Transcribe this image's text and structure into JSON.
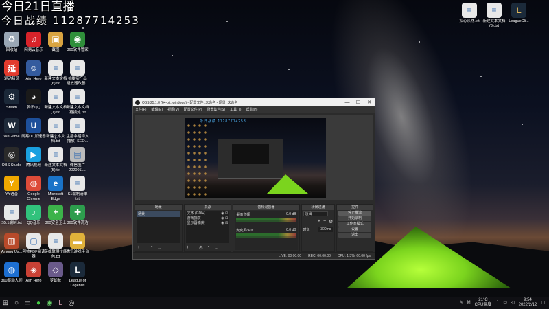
{
  "overlay": {
    "line1": "今日21日直播",
    "line2": "今日战绩 11287714253"
  },
  "desktop": {
    "icons": [
      {
        "label": "回收站",
        "icon": "recycle-bin-icon",
        "color": "#9aa7b5",
        "glyph": "♻"
      },
      {
        "label": "网易云音乐",
        "icon": "netease-music-icon",
        "color": "#d8232a",
        "glyph": "♫"
      },
      {
        "label": "截图",
        "icon": "screenshot-icon",
        "color": "#d9a441",
        "glyph": "▣"
      },
      {
        "label": "360软件管家",
        "icon": "360-software-icon",
        "color": "#2f8f3a",
        "glyph": "◉"
      },
      {
        "label": "驱动精灵",
        "icon": "driver-icon",
        "color": "#e23b2e",
        "glyph": "延"
      },
      {
        "label": "Aim Hero",
        "icon": "aim-hero-icon",
        "color": "#345b9e",
        "glyph": "☺"
      },
      {
        "label": "新建文本文档\n(6).txt",
        "icon": "text-file-icon",
        "color": "#e8e8e8",
        "glyph": "≡"
      },
      {
        "label": "拍摄实产出\n播放器改善...",
        "icon": "text-file-icon",
        "color": "#e8e8e8",
        "glyph": "≡"
      },
      {
        "label": "Steam",
        "icon": "steam-icon",
        "color": "#1b2838",
        "glyph": "⚙"
      },
      {
        "label": "腾讯QQ",
        "icon": "qq-icon",
        "color": "#1a1a1a",
        "glyph": "◕"
      },
      {
        "label": "新建文本文档\n(7).txt",
        "icon": "text-file-icon",
        "color": "#e8e8e8",
        "glyph": "≡"
      },
      {
        "label": "新建文本文档\n链接处.txt",
        "icon": "text-file-icon",
        "color": "#e8e8e8",
        "glyph": "≡"
      },
      {
        "label": "WeGame",
        "icon": "wegame-icon",
        "color": "#1e2a3a",
        "glyph": "W"
      },
      {
        "label": "网易UU加速器",
        "icon": "uu-accelerator-icon",
        "color": "#1d4f9a",
        "glyph": "U"
      },
      {
        "label": "新建文本文\n档.txt",
        "icon": "text-file-icon",
        "color": "#e8e8e8",
        "glyph": "≡"
      },
      {
        "label": "主播伞招待入\n播放 -SEO...",
        "icon": "text-file-icon",
        "color": "#e8e8e8",
        "glyph": "≡"
      },
      {
        "label": "OBS Studio",
        "icon": "obs-icon",
        "color": "#2a2a2a",
        "glyph": "◎"
      },
      {
        "label": "腾讯视频",
        "icon": "tencent-video-icon",
        "color": "#1aa0e0",
        "glyph": "▶"
      },
      {
        "label": "新建文本文档\n(5).txt",
        "icon": "text-file-icon",
        "color": "#e8e8e8",
        "glyph": "≡"
      },
      {
        "label": "微信图片\n2020011...",
        "icon": "image-file-icon",
        "color": "#bbbbbb",
        "glyph": "▤"
      },
      {
        "label": "YY语音",
        "icon": "yy-icon",
        "color": "#f0a800",
        "glyph": "Y"
      },
      {
        "label": "Google\nChrome",
        "icon": "chrome-icon",
        "color": "#dd4b39",
        "glyph": "◍"
      },
      {
        "label": "Microsoft\nEdge",
        "icon": "edge-icon",
        "color": "#1a73c8",
        "glyph": "e"
      },
      {
        "label": "S1编制清单\ntxt",
        "icon": "text-file-icon",
        "color": "#e8e8e8",
        "glyph": "≡"
      },
      {
        "label": "S5.1编制.txt",
        "icon": "text-file-icon",
        "color": "#e8e8e8",
        "glyph": "≡"
      },
      {
        "label": "QQ音乐",
        "icon": "qq-music-icon",
        "color": "#31c27c",
        "glyph": "♪"
      },
      {
        "label": "360安全卫士",
        "icon": "360-security-icon",
        "color": "#3cb34a",
        "glyph": "+"
      },
      {
        "label": "360软件清洁",
        "icon": "360-clean-icon",
        "color": "#2d9d4d",
        "glyph": "✚"
      },
      {
        "label": "Among Us...",
        "icon": "among-us-icon",
        "color": "#b84a2a",
        "glyph": "▥"
      },
      {
        "label": "阿帅PDF阅读\n器",
        "icon": "pdf-reader-icon",
        "color": "#e8e8e8",
        "glyph": "▢"
      },
      {
        "label": "英雄联盟技能\n包.txt",
        "icon": "text-file-icon",
        "color": "#e8e8e8",
        "glyph": "≡"
      },
      {
        "label": "腾讯游戏平台",
        "icon": "folder-icon",
        "color": "#e0b13a",
        "glyph": "▬"
      },
      {
        "label": "360驱动大师",
        "icon": "360-driver-icon",
        "color": "#1d6fd1",
        "glyph": "◍"
      },
      {
        "label": "Aim Hero",
        "icon": "aim-hero-icon",
        "color": "#c94135",
        "glyph": "◈"
      },
      {
        "label": "梦幻轮",
        "icon": "game-icon",
        "color": "#6a5a8a",
        "glyph": "◇"
      },
      {
        "label": "League of\nLegends",
        "icon": "league-icon",
        "color": "#1b2a3a",
        "glyph": "L"
      }
    ],
    "right_icons": [
      {
        "label": "扣心从然.txt",
        "icon": "text-file-icon",
        "color": "#e8e8e8",
        "glyph": "≡"
      },
      {
        "label": "新建文本文档\n(3).txt",
        "icon": "text-file-icon",
        "color": "#e8e8e8",
        "glyph": "≡"
      },
      {
        "label": "LeagueCli...",
        "icon": "league-client-icon",
        "color": "#1b2a3a",
        "glyph": "L"
      }
    ]
  },
  "obs": {
    "title": "OBS 25.1.0 (64-bit, windows) - 配置文件: 未命名 - 场景: 未命名",
    "menu": [
      "文件(F)",
      "编辑(E)",
      "视图(V)",
      "配置文件(P)",
      "场景集合(S)",
      "工具(T)",
      "帮助(H)"
    ],
    "canvas_text": "今日战绩 11287714253",
    "docks": {
      "scenes": {
        "title": "场景",
        "items": [
          "场景"
        ]
      },
      "sources": {
        "title": "来源",
        "items": [
          "文本 (GDI+)",
          "游戏捕获",
          "显示器捕获"
        ]
      },
      "mixer": {
        "title": "音频混音器",
        "channels": [
          {
            "name": "桌面音频",
            "db": "0.0 dB"
          },
          {
            "name": "麦克风/Aux",
            "db": "0.0 dB"
          }
        ]
      },
      "transitions": {
        "title": "场景过渡",
        "selected": "淡出",
        "duration_label": "时长",
        "duration": "300ms"
      },
      "controls": {
        "title": "控件",
        "buttons": [
          "停止推流",
          "开始录制",
          "工作室模式",
          "设置",
          "退出"
        ]
      }
    },
    "status": {
      "live": "LIVE: 00:00:00",
      "rec": "REC: 00:00:00",
      "cpu": "CPU: 1.3%, 60.00 fps"
    }
  },
  "taskbar": {
    "temperature": "21°C",
    "weather": "CPU温度",
    "time": "9:54",
    "date": "2022/2/12"
  }
}
